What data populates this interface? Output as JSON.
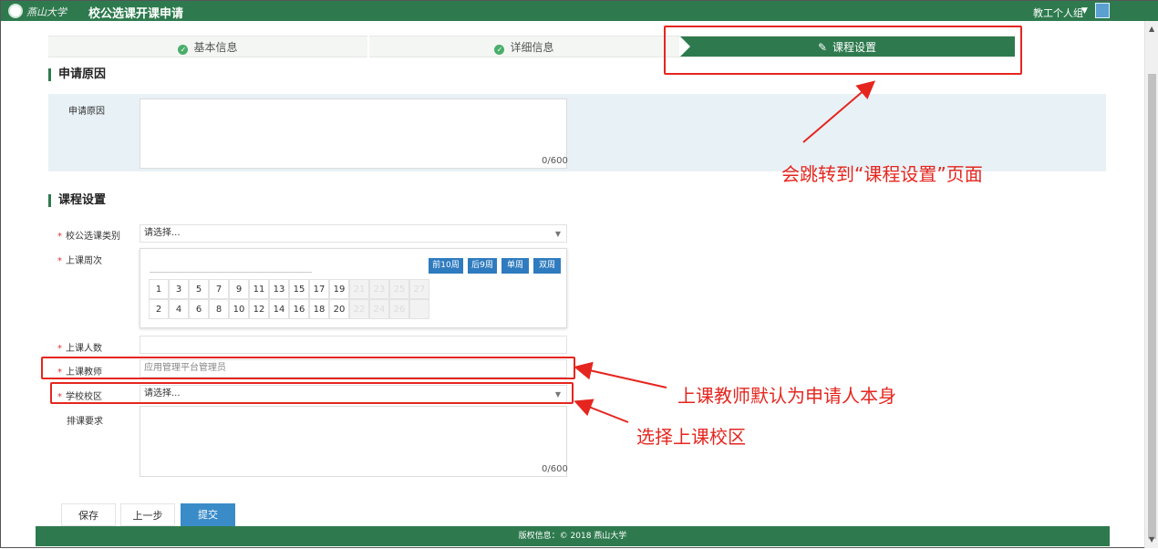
{
  "header": {
    "logo_text": "燕山大学",
    "title": "校公选课开课申请",
    "user_group": "教工个人组"
  },
  "steps": [
    {
      "label": "基本信息",
      "state": "done"
    },
    {
      "label": "详细信息",
      "state": "done"
    },
    {
      "label": "课程设置",
      "state": "active"
    }
  ],
  "reason_section": {
    "title": "申请原因",
    "field_label": "申请原因",
    "value": "",
    "counter": "0/600"
  },
  "course_section": {
    "title": "课程设置",
    "category_label": "校公选课类别",
    "category_value": "请选择...",
    "weeks_label": "上课周次",
    "week_buttons": [
      "前10周",
      "后9周",
      "单周",
      "双周"
    ],
    "week_rows": [
      [
        "1",
        "3",
        "5",
        "7",
        "9",
        "11",
        "13",
        "15",
        "17",
        "19",
        "21",
        "23",
        "25",
        "27"
      ],
      [
        "2",
        "4",
        "6",
        "8",
        "10",
        "12",
        "14",
        "16",
        "18",
        "20",
        "22",
        "24",
        "26",
        ""
      ]
    ],
    "week_disabled_from_index": 10,
    "count_label": "上课人数",
    "count_value": "",
    "teacher_label": "上课教师",
    "teacher_value": "应用管理平台管理员",
    "campus_label": "学校校区",
    "campus_value": "请选择...",
    "schedule_label": "排课要求",
    "schedule_value": "",
    "schedule_counter": "0/600"
  },
  "actions": {
    "save": "保存",
    "prev": "上一步",
    "submit": "提交"
  },
  "footer": "版权信息：© 2018 燕山大学",
  "annotations": {
    "jump": "会跳转到“课程设置”页面",
    "teacher": "上课教师默认为申请人本身",
    "campus": "选择上课校区"
  },
  "colors": {
    "brand_green": "#2e7a4e",
    "accent_blue": "#2f7bbf",
    "annotation_red": "#e5261f"
  }
}
